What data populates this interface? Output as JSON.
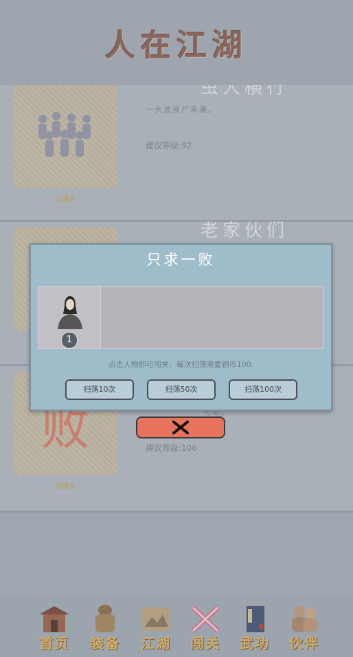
{
  "header": {
    "title": "人在江湖"
  },
  "levels": [
    {
      "name": "虫人横行",
      "desc": "一大波良尸来袭。",
      "level": "建议等级:92",
      "status": "已通关"
    },
    {
      "name": "老家伙们",
      "desc": "",
      "level": "",
      "status": ""
    },
    {
      "name": "",
      "desc": "可丢。",
      "level": "建议等级:106",
      "status": "已通关",
      "thumb_text": "败"
    }
  ],
  "dialog": {
    "title": "只求一败",
    "slot_badge": "1",
    "hint": "点击人物即可闯关，每次扫荡需要铜币100.",
    "buttons": [
      "扫荡10次",
      "扫荡50次",
      "扫荡100次"
    ]
  },
  "nav": [
    "首页",
    "装备",
    "江湖",
    "闯关",
    "武功",
    "伙伴"
  ],
  "colors": {
    "accent": "#e8735d",
    "dialog_bg": "#9fbccb",
    "nav_label": "#e8b75a"
  }
}
